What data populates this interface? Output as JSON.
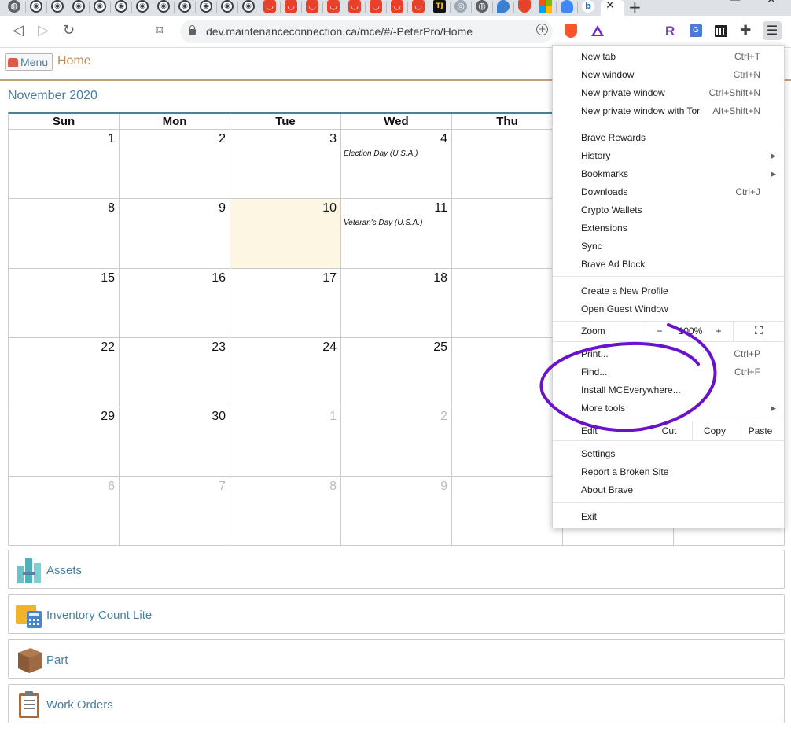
{
  "browser": {
    "address_bar": {
      "url": "dev.maintenanceconnection.ca/mce/#/-PeterPro/Home"
    },
    "tab_close_glyph": "✕",
    "new_tab_glyph": "+",
    "app_menu_glyph": "☰",
    "extensions": [
      "brave-shields-icon",
      "brave-rewards-icon",
      "r-extension-icon",
      "translate-icon",
      "bank-icon",
      "extensions-puzzle-icon"
    ]
  },
  "page": {
    "menu_button_label": "Menu",
    "breadcrumb_home": "Home",
    "month_title": "November 2020"
  },
  "calendar": {
    "weekdays": [
      "Sun",
      "Mon",
      "Tue",
      "Wed",
      "Thu",
      "",
      ""
    ],
    "weeks": [
      [
        {
          "day": "1"
        },
        {
          "day": "2"
        },
        {
          "day": "3"
        },
        {
          "day": "4",
          "event": "Election Day (U.S.A.)"
        },
        {
          "day": ""
        },
        {
          "day": ""
        },
        {
          "day": ""
        }
      ],
      [
        {
          "day": "8"
        },
        {
          "day": "9"
        },
        {
          "day": "10",
          "today": true
        },
        {
          "day": "11",
          "event": "Veteran's Day (U.S.A.)"
        },
        {
          "day": ""
        },
        {
          "day": ""
        },
        {
          "day": ""
        }
      ],
      [
        {
          "day": "15"
        },
        {
          "day": "16"
        },
        {
          "day": "17"
        },
        {
          "day": "18"
        },
        {
          "day": ""
        },
        {
          "day": ""
        },
        {
          "day": ""
        }
      ],
      [
        {
          "day": "22"
        },
        {
          "day": "23"
        },
        {
          "day": "24"
        },
        {
          "day": "25"
        },
        {
          "day": ""
        },
        {
          "day": ""
        },
        {
          "day": ""
        }
      ],
      [
        {
          "day": "29"
        },
        {
          "day": "30"
        },
        {
          "day": "1",
          "dim": true
        },
        {
          "day": "2",
          "dim": true
        },
        {
          "day": ""
        },
        {
          "day": ""
        },
        {
          "day": ""
        }
      ],
      [
        {
          "day": "6",
          "dim": true
        },
        {
          "day": "7",
          "dim": true
        },
        {
          "day": "8",
          "dim": true
        },
        {
          "day": "9",
          "dim": true
        },
        {
          "day": ""
        },
        {
          "day": ""
        },
        {
          "day": ""
        }
      ]
    ]
  },
  "modules": [
    {
      "label": "Assets",
      "icon": "buildings-icon"
    },
    {
      "label": "Inventory Count Lite",
      "icon": "calculator-icon"
    },
    {
      "label": "Part",
      "icon": "box-icon"
    },
    {
      "label": "Work Orders",
      "icon": "clipboard-icon"
    }
  ],
  "browser_menu": {
    "new_tab": {
      "label": "New tab",
      "shortcut": "Ctrl+T"
    },
    "new_window": {
      "label": "New window",
      "shortcut": "Ctrl+N"
    },
    "new_private_window": {
      "label": "New private window",
      "shortcut": "Ctrl+Shift+N"
    },
    "new_private_tor": {
      "label": "New private window with Tor",
      "shortcut": "Alt+Shift+N"
    },
    "brave_rewards": {
      "label": "Brave Rewards"
    },
    "history": {
      "label": "History"
    },
    "bookmarks": {
      "label": "Bookmarks"
    },
    "downloads": {
      "label": "Downloads",
      "shortcut": "Ctrl+J"
    },
    "crypto_wallets": {
      "label": "Crypto Wallets"
    },
    "extensions": {
      "label": "Extensions"
    },
    "sync": {
      "label": "Sync"
    },
    "ad_block": {
      "label": "Brave Ad Block"
    },
    "new_profile": {
      "label": "Create a New Profile"
    },
    "guest": {
      "label": "Open Guest Window"
    },
    "zoom": {
      "label": "Zoom",
      "minus": "−",
      "value": "100%",
      "plus": "+"
    },
    "print": {
      "label": "Print...",
      "shortcut": "Ctrl+P"
    },
    "find": {
      "label": "Find...",
      "shortcut": "Ctrl+F"
    },
    "install": {
      "label": "Install MCEverywhere..."
    },
    "more_tools": {
      "label": "More tools"
    },
    "edit": {
      "label": "Edit",
      "cut": "Cut",
      "copy": "Copy",
      "paste": "Paste"
    },
    "settings": {
      "label": "Settings"
    },
    "report": {
      "label": "Report a Broken Site"
    },
    "about": {
      "label": "About Brave"
    },
    "exit": {
      "label": "Exit"
    }
  },
  "colors": {
    "accent": "#4a7f9e",
    "home_crumb": "#c08a55",
    "today_bg": "#fdf6e3",
    "annotation": "#6a11cb"
  }
}
